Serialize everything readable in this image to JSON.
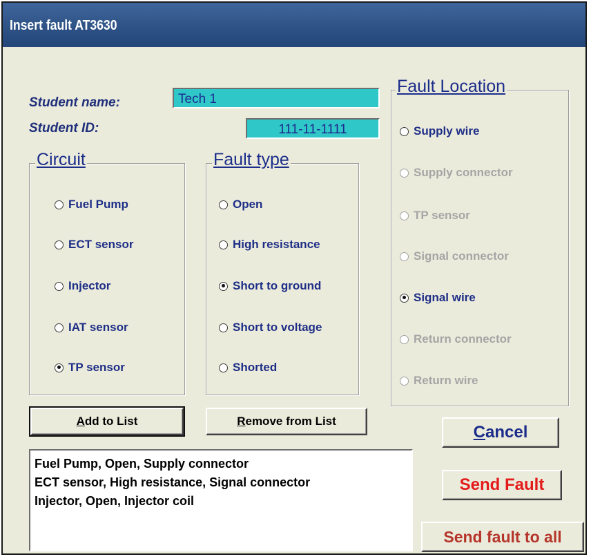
{
  "window": {
    "title": "Insert fault AT3630"
  },
  "student": {
    "name_label": "Student name:",
    "name_value": "Tech 1",
    "id_label": "Student ID:",
    "id_value": "111-11-1111"
  },
  "circuit": {
    "title": "Circuit",
    "options": [
      {
        "label": "Fuel Pump",
        "selected": false
      },
      {
        "label": "ECT sensor",
        "selected": false
      },
      {
        "label": "Injector",
        "selected": false
      },
      {
        "label": "IAT sensor",
        "selected": false
      },
      {
        "label": "TP sensor",
        "selected": true
      }
    ]
  },
  "fault_type": {
    "title": "Fault type",
    "options": [
      {
        "label": "Open",
        "selected": false
      },
      {
        "label": "High resistance",
        "selected": false
      },
      {
        "label": "Short to ground",
        "selected": true
      },
      {
        "label": "Short to voltage",
        "selected": false
      },
      {
        "label": "Shorted",
        "selected": false
      }
    ]
  },
  "fault_location": {
    "title": "Fault Location",
    "options": [
      {
        "label": "Supply wire",
        "selected": false,
        "enabled": true
      },
      {
        "label": "Supply connector",
        "selected": false,
        "enabled": false
      },
      {
        "label": "TP sensor",
        "selected": false,
        "enabled": false
      },
      {
        "label": "Signal connector",
        "selected": false,
        "enabled": false
      },
      {
        "label": "Signal wire",
        "selected": true,
        "enabled": true
      },
      {
        "label": "Return connector",
        "selected": false,
        "enabled": false
      },
      {
        "label": "Return wire",
        "selected": false,
        "enabled": false
      }
    ]
  },
  "buttons": {
    "add": {
      "prefix": "A",
      "rest": "dd to List"
    },
    "remove": {
      "prefix": "R",
      "rest": "emove from List"
    },
    "cancel": {
      "prefix": "C",
      "rest": "ancel"
    },
    "send": "Send Fault",
    "send_all": "Send fault to all"
  },
  "fault_list": [
    "Fuel Pump, Open, Supply connector",
    "ECT sensor, High resistance, Signal connector",
    "Injector, Open, Injector coil"
  ],
  "colors": {
    "title_bar": "#2d5184",
    "field_bg": "#2fc7c7",
    "label_blue": "#1e2e86",
    "send_red": "#e41b1b",
    "send_all_red": "#b5352a",
    "disabled": "#a5a5a5"
  }
}
